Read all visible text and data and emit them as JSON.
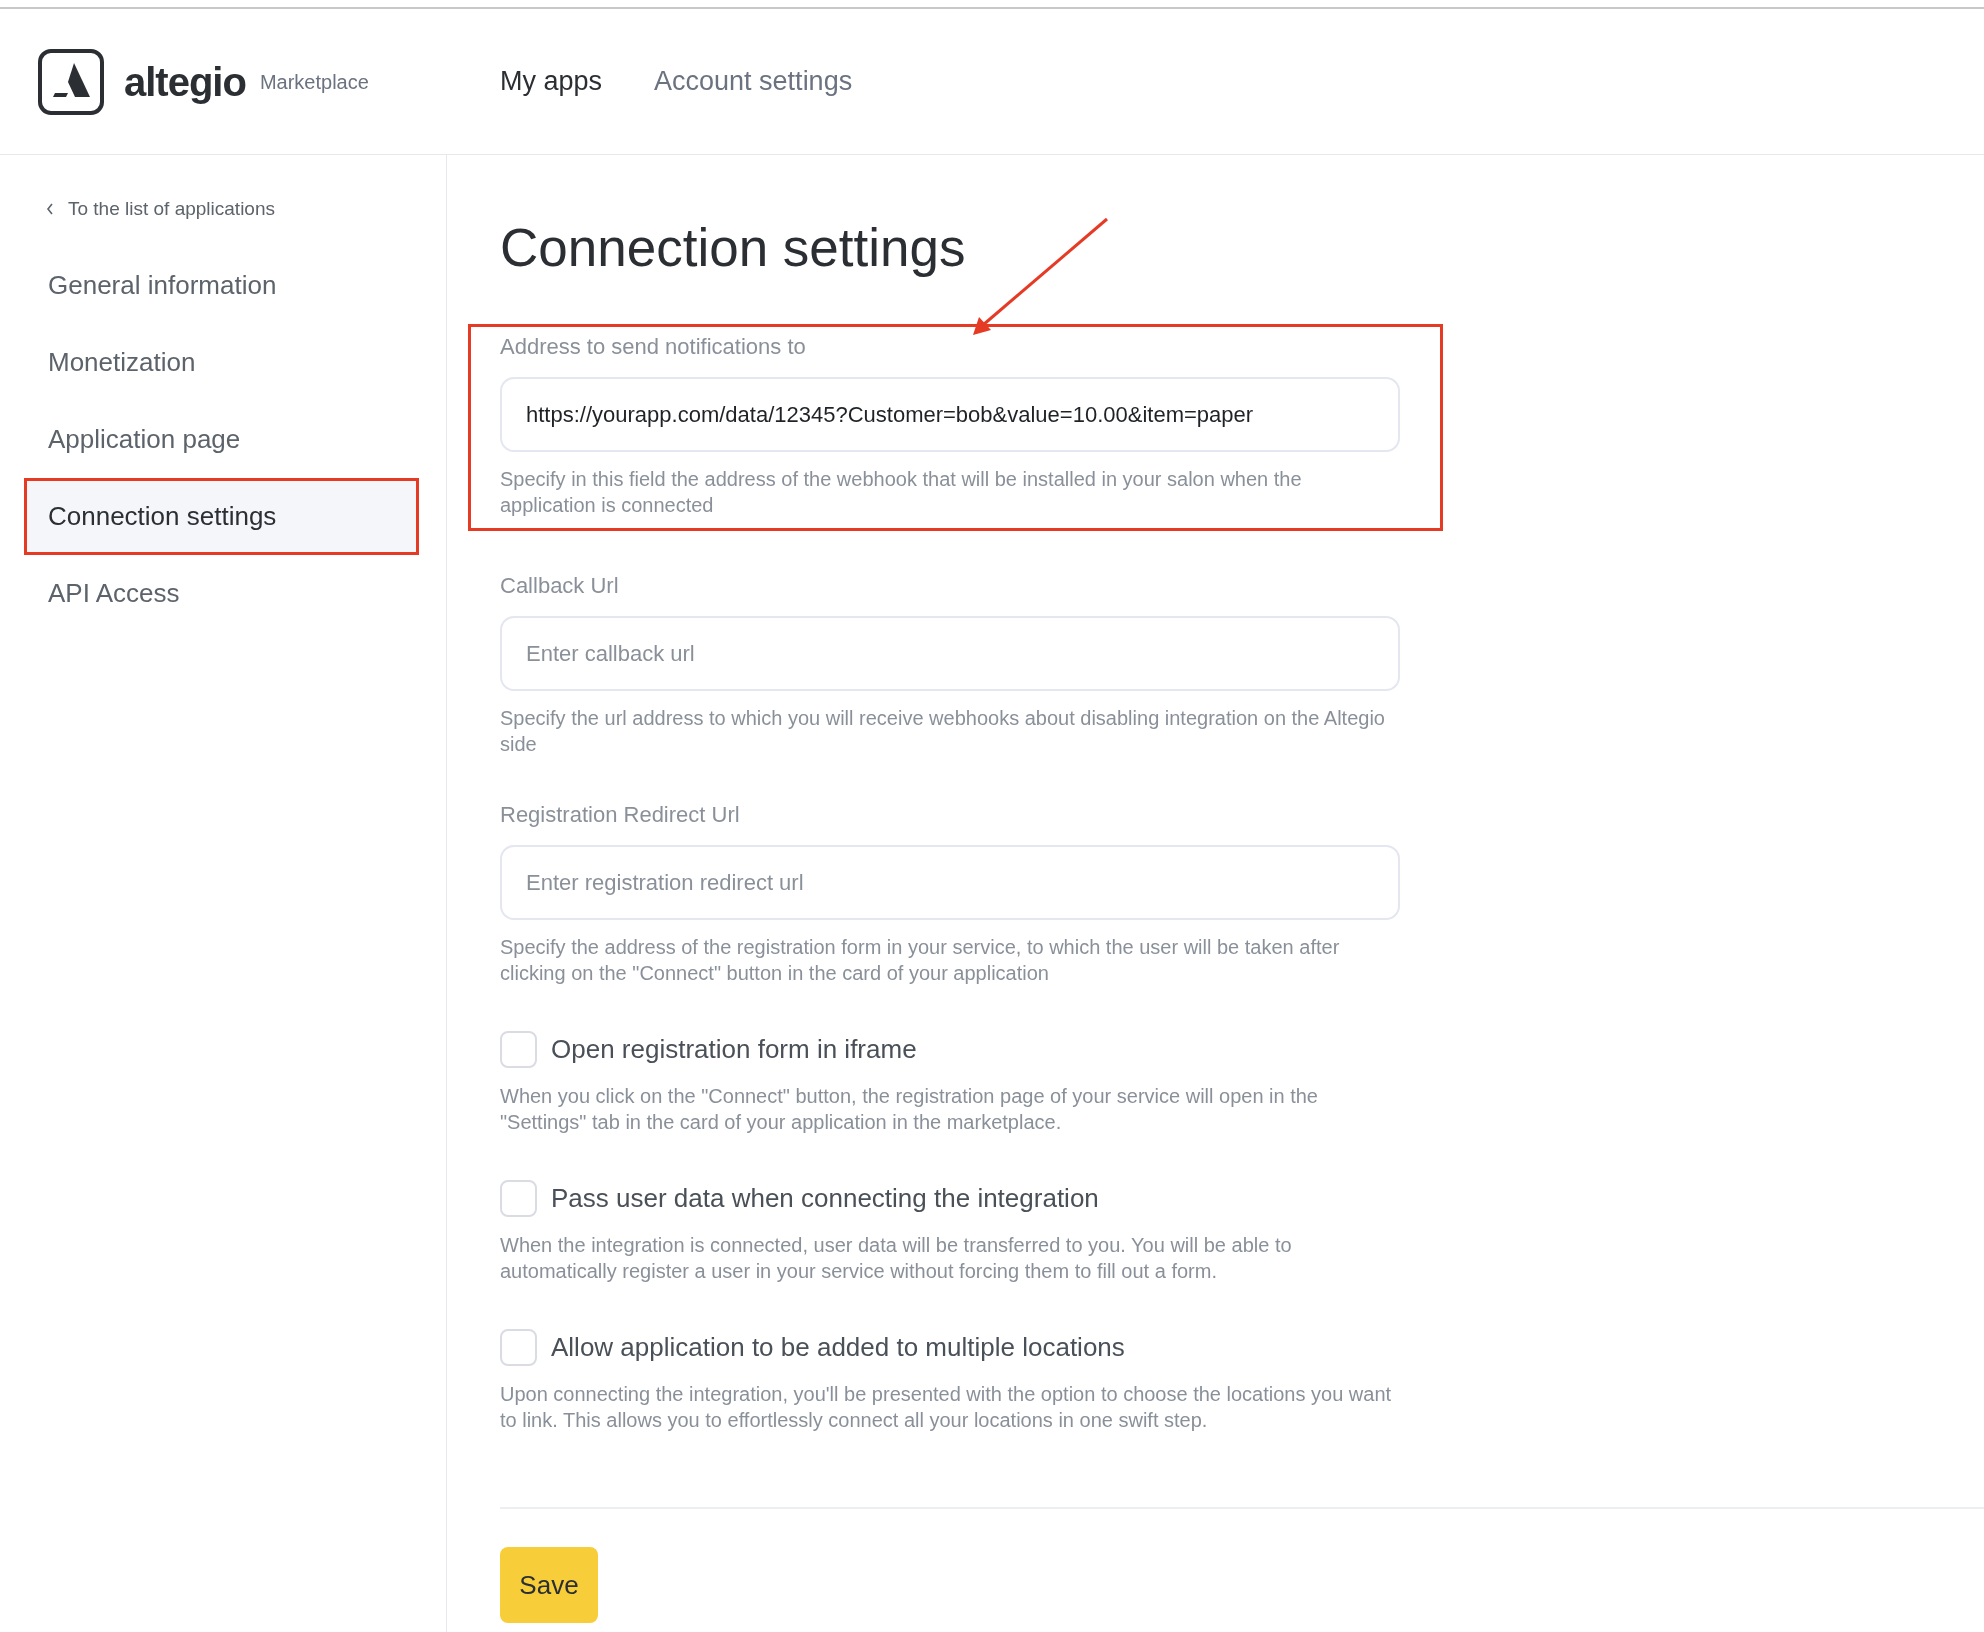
{
  "header": {
    "logo_text": "altegio",
    "logo_subtitle": "Marketplace",
    "nav": [
      {
        "label": "My apps",
        "selected": true
      },
      {
        "label": "Account settings",
        "selected": false
      }
    ]
  },
  "sidebar": {
    "back_link": "To the list of applications",
    "items": [
      {
        "label": "General information",
        "selected": false,
        "highlighted": false
      },
      {
        "label": "Monetization",
        "selected": false,
        "highlighted": false
      },
      {
        "label": "Application page",
        "selected": false,
        "highlighted": false
      },
      {
        "label": "Connection settings",
        "selected": true,
        "highlighted": true
      },
      {
        "label": "API Access",
        "selected": false,
        "highlighted": false
      }
    ]
  },
  "main": {
    "title": "Connection settings",
    "title_arrow": true,
    "fields": [
      {
        "kind": "text",
        "label": "Address to send notifications to",
        "value": "https://yourapp.com/data/12345?Customer=bob&value=10.00&item=paper",
        "help": "Specify in this field the address of the webhook that will be installed in your salon when the application is connected",
        "highlighted": true
      },
      {
        "kind": "text",
        "label": "Callback Url",
        "placeholder": "Enter callback url",
        "help": "Specify the url address to which you will receive webhooks about disabling integration on the Altegio side",
        "highlighted": false
      },
      {
        "kind": "text",
        "label": "Registration Redirect Url",
        "placeholder": "Enter registration redirect url",
        "help": "Specify the address of the registration form in your service, to which the user will be taken after clicking on the \"Connect\" button in the card of your application",
        "highlighted": false
      },
      {
        "kind": "checkbox",
        "label": "Open registration form in iframe",
        "checked": false,
        "help": "When you click on the \"Connect\" button, the registration page of your service will open in the \"Settings\" tab in the card of your application in the marketplace.",
        "highlighted": false
      },
      {
        "kind": "checkbox",
        "label": "Pass user data when connecting the integration",
        "checked": false,
        "help": "When the integration is connected, user data will be transferred to you. You will be able to automatically register a user in your service without forcing them to fill out a form.",
        "highlighted": false
      },
      {
        "kind": "checkbox",
        "label": "Allow application to be added to multiple locations",
        "checked": false,
        "help": "Upon connecting the integration, you'll be presented with the option to choose the locations you want to link. This allows you to effortlessly connect all your locations in one swift step.",
        "highlighted": false
      }
    ],
    "save_button": "Save"
  }
}
